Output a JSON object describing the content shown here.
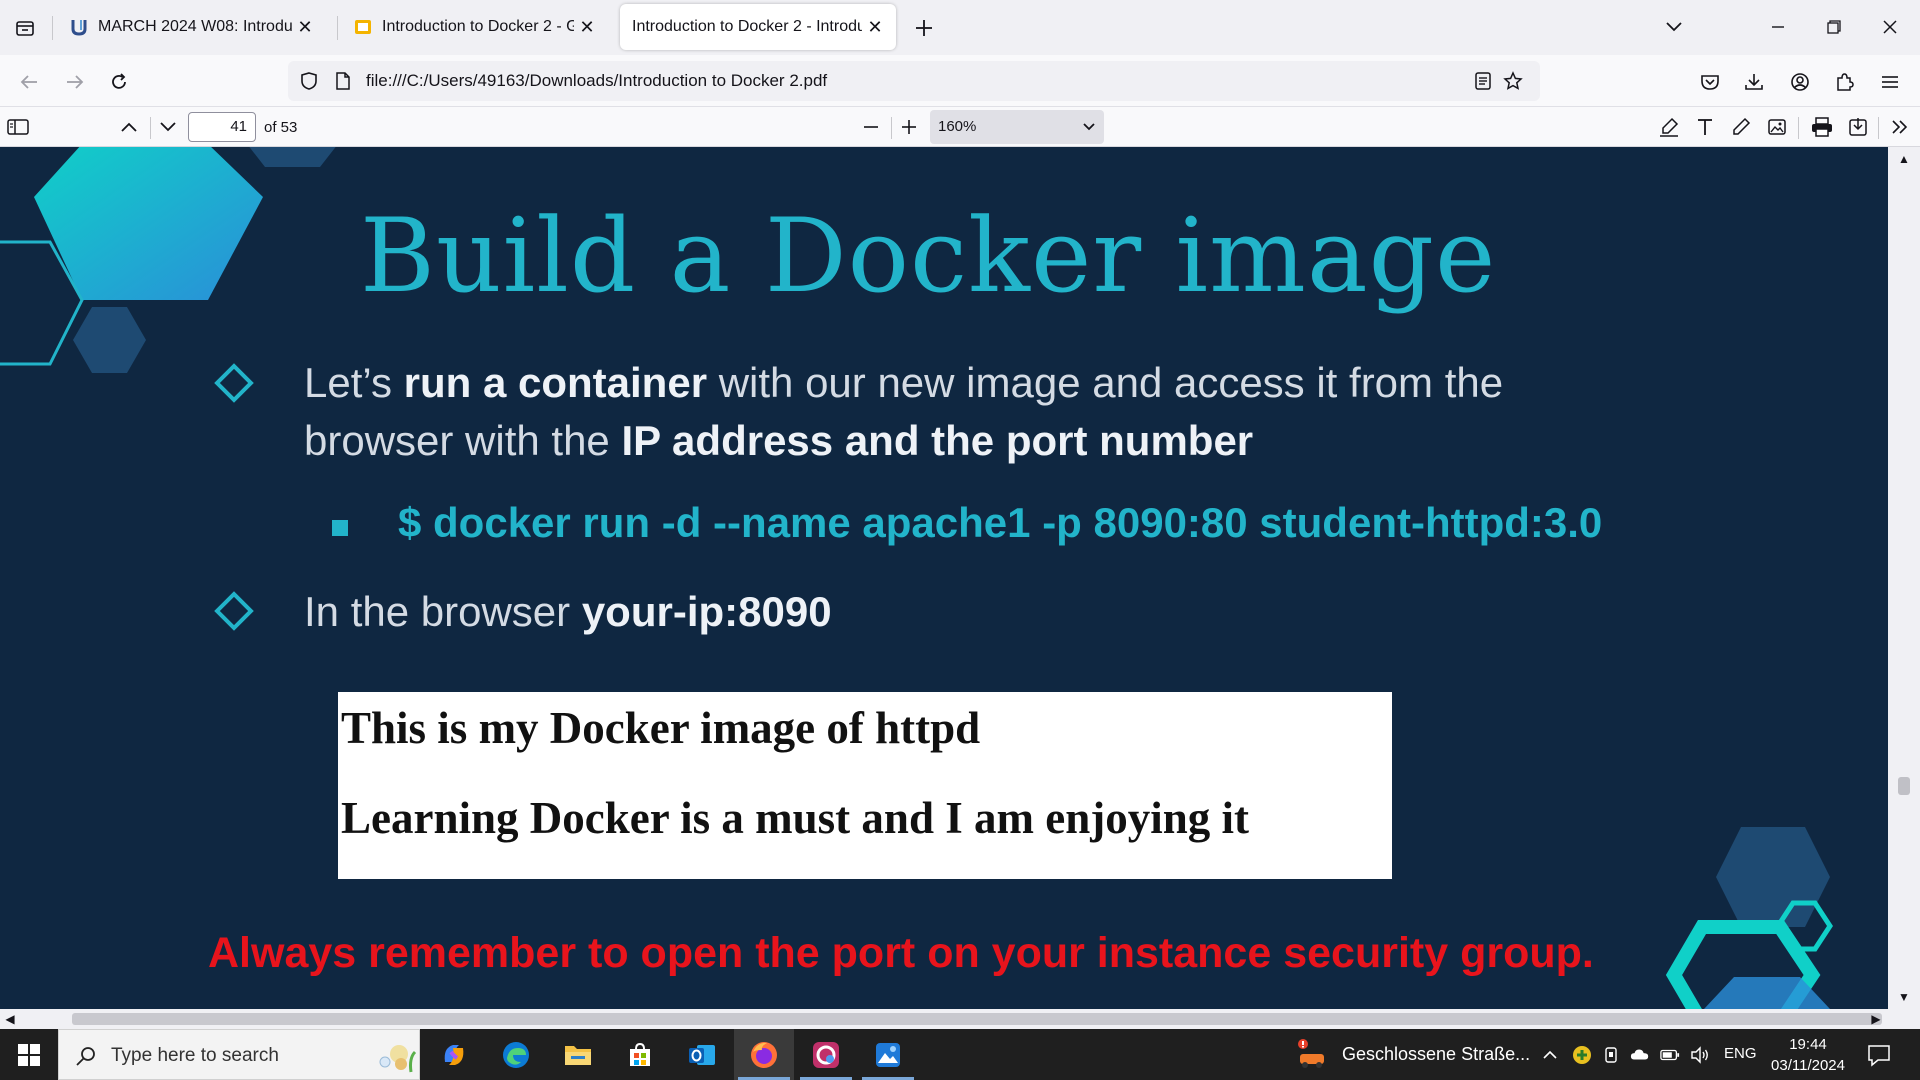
{
  "browser": {
    "tabs": [
      {
        "title": "MARCH 2024 W08: Introductio",
        "favicon": "u-logo-icon",
        "active": false
      },
      {
        "title": "Introduction to Docker 2 - Goo",
        "favicon": "slides-icon",
        "active": false
      },
      {
        "title": "Introduction to Docker 2 - Introduc",
        "favicon": "none",
        "active": true
      }
    ],
    "url": "file:///C:/Users/49163/Downloads/Introduction to Docker 2.pdf"
  },
  "pdf_toolbar": {
    "page_number": "41",
    "page_total": "of 53",
    "zoom": "160%"
  },
  "slide": {
    "title": "Build a Docker image",
    "bullet1": {
      "p1": "Let’s ",
      "b1": "run a container",
      "p2": " with our new image and access it from the",
      "p3": "browser with the ",
      "b2": "IP address and the port number"
    },
    "command": "$ docker run -d --name apache1 -p 8090:80 student-httpd:3.0",
    "bullet2": {
      "p1": "In the browser ",
      "b1": "your-ip:8090"
    },
    "screenshot": {
      "line1": "This is my Docker image of httpd",
      "line2": "Learning Docker is a must and I am enjoying it"
    },
    "warning": "Always remember to open the port on your instance security group.",
    "colors": {
      "background": "#0f2741",
      "accent": "#22b4ca",
      "warning": "#e8141c"
    }
  },
  "taskbar": {
    "search_placeholder": "Type here to search",
    "news": "Geschlossene Straße...",
    "language": "ENG",
    "time": "19:44",
    "date": "03/11/2024"
  }
}
